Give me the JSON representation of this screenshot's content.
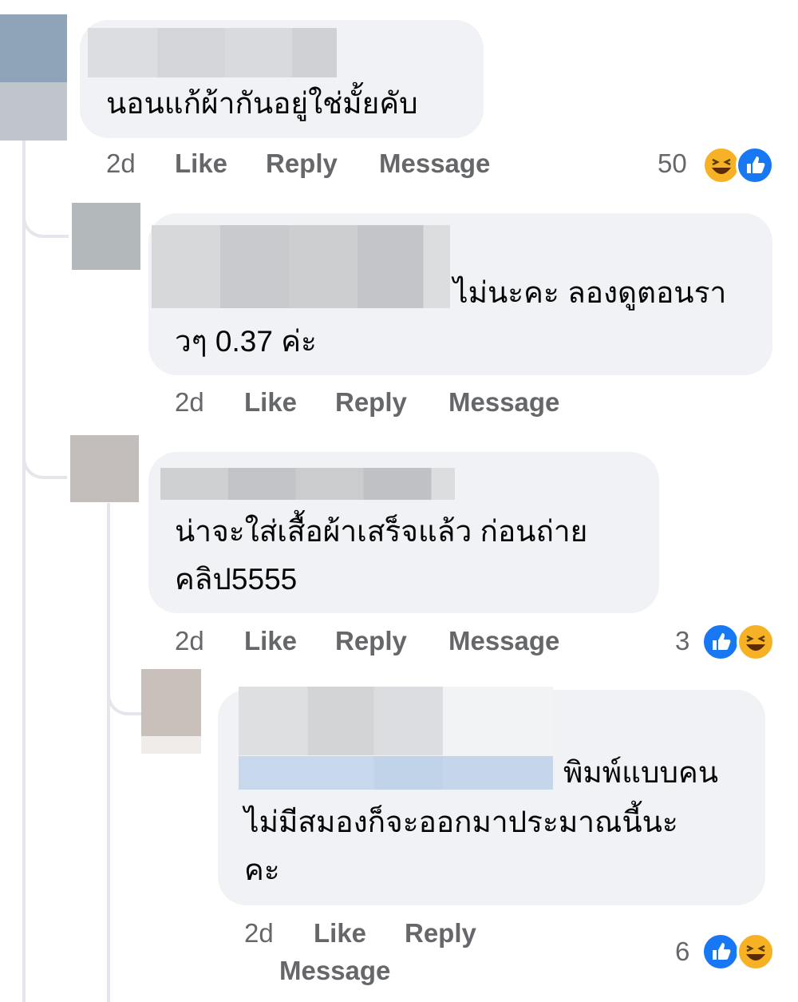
{
  "comments": [
    {
      "text": "นอนแก้ผ้ากันอยู่ใช่มั้ยคับ",
      "time": "2d",
      "like": "Like",
      "reply": "Reply",
      "message": "Message",
      "reaction_count": "50",
      "reactions": [
        "haha-icon",
        "like-icon"
      ]
    },
    {
      "text_line1_tail": "ไม่นะคะ ลองดูตอนรา",
      "text_line2": "วๆ 0.37 ค่ะ",
      "time": "2d",
      "like": "Like",
      "reply": "Reply",
      "message": "Message"
    },
    {
      "text": "น่าจะใส่เสื้อผ้าเสร็จแล้ว ก่อนถ่าย\nคลิป5555",
      "time": "2d",
      "like": "Like",
      "reply": "Reply",
      "message": "Message",
      "reaction_count": "3",
      "reactions": [
        "like-icon",
        "haha-icon"
      ]
    },
    {
      "text_line1_tail": "พิมพ์แบบคน",
      "text_rest": "ไม่มีสมองก็จะออกมาประมาณนี้นะ\nคะ",
      "time": "2d",
      "like": "Like",
      "reply": "Reply",
      "message": "Message",
      "reaction_count": "6",
      "reactions": [
        "like-icon",
        "haha-icon"
      ]
    }
  ],
  "colors": {
    "bubble": "#f0f2f5",
    "meta_text": "#65676b",
    "like_blue": "#1877f2",
    "haha_yellow": "#f7b125"
  }
}
